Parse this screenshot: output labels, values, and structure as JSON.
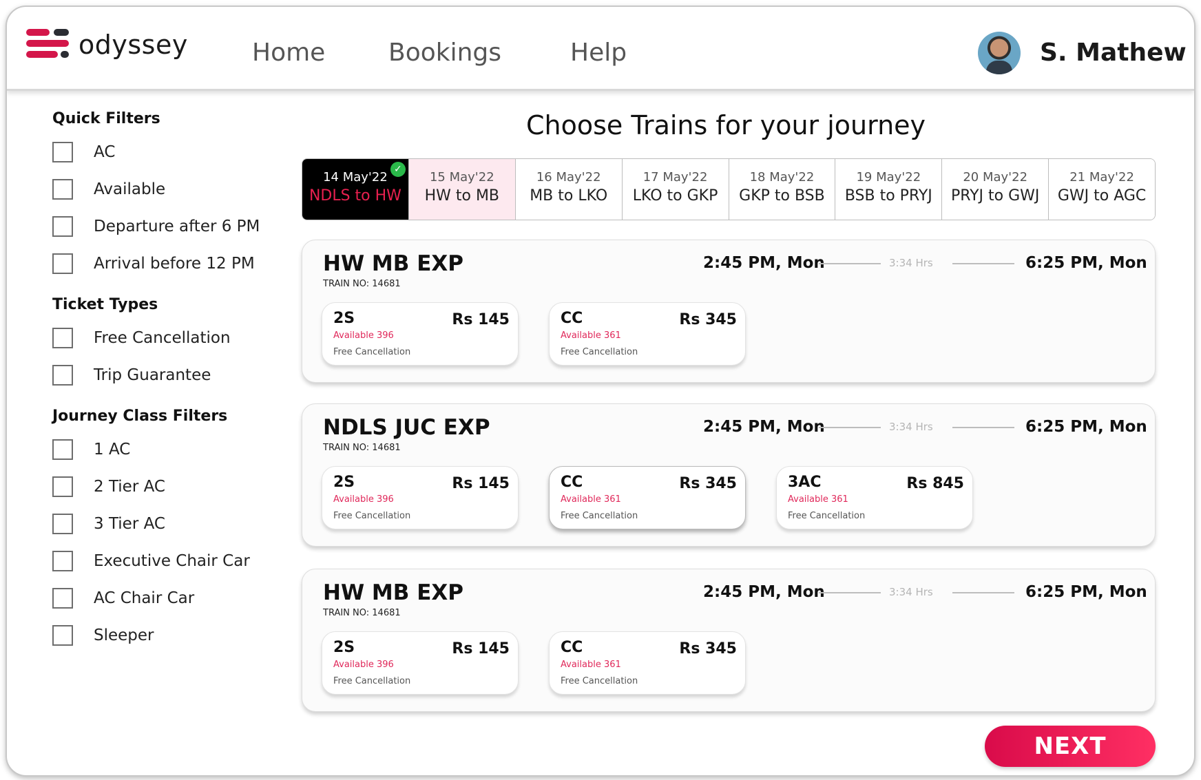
{
  "app": {
    "name": "odyssey"
  },
  "nav": {
    "home": "Home",
    "bookings": "Bookings",
    "help": "Help"
  },
  "user": {
    "name": "S. Mathew"
  },
  "page": {
    "title": "Choose Trains for your journey"
  },
  "sidebar": {
    "quick_title": "Quick Filters",
    "quick": [
      "AC",
      "Available",
      "Departure after 6 PM",
      "Arrival before 12 PM"
    ],
    "ticket_title": "Ticket Types",
    "ticket": [
      "Free Cancellation",
      "Trip Guarantee"
    ],
    "class_title": "Journey Class Filters",
    "classes": [
      "1 AC",
      "2 Tier AC",
      "3 Tier AC",
      "Executive Chair Car",
      "AC Chair Car",
      "Sleeper"
    ]
  },
  "tabs": [
    {
      "date": "14 May'22",
      "route": "NDLS to HW"
    },
    {
      "date": "15 May'22",
      "route": "HW to MB"
    },
    {
      "date": "16 May'22",
      "route": "MB to LKO"
    },
    {
      "date": "17 May'22",
      "route": "LKO to GKP"
    },
    {
      "date": "18 May'22",
      "route": "GKP to BSB"
    },
    {
      "date": "19 May'22",
      "route": "BSB to PRYJ"
    },
    {
      "date": "20 May'22",
      "route": "PRYJ to GWJ"
    },
    {
      "date": "21 May'22",
      "route": "GWJ to AGC"
    }
  ],
  "trains": [
    {
      "name": "HW MB EXP",
      "train_no": "TRAIN NO: 14681",
      "depart": "2:45 PM, Mon",
      "duration": "3:34 Hrs",
      "arrive": "6:25 PM, Mon",
      "fares": [
        {
          "cls": "2S",
          "price": "Rs 145",
          "avail": "Available 396",
          "cancel": "Free Cancellation"
        },
        {
          "cls": "CC",
          "price": "Rs 345",
          "avail": "Available 361",
          "cancel": "Free Cancellation"
        }
      ]
    },
    {
      "name": "NDLS JUC EXP",
      "train_no": "TRAIN NO: 14681",
      "depart": "2:45 PM, Mon",
      "duration": "3:34 Hrs",
      "arrive": "6:25 PM, Mon",
      "fares": [
        {
          "cls": "2S",
          "price": "Rs 145",
          "avail": "Available 396",
          "cancel": "Free Cancellation"
        },
        {
          "cls": "CC",
          "price": "Rs 345",
          "avail": "Available 361",
          "cancel": "Free Cancellation"
        },
        {
          "cls": "3AC",
          "price": "Rs 845",
          "avail": "Available 361",
          "cancel": "Free Cancellation"
        }
      ]
    },
    {
      "name": "HW MB EXP",
      "train_no": "TRAIN NO: 14681",
      "depart": "2:45 PM, Mon",
      "duration": "3:34 Hrs",
      "arrive": "6:25 PM, Mon",
      "fares": [
        {
          "cls": "2S",
          "price": "Rs 145",
          "avail": "Available 396",
          "cancel": "Free Cancellation"
        },
        {
          "cls": "CC",
          "price": "Rs 345",
          "avail": "Available 361",
          "cancel": "Free Cancellation"
        }
      ]
    }
  ],
  "next_label": "NEXT"
}
